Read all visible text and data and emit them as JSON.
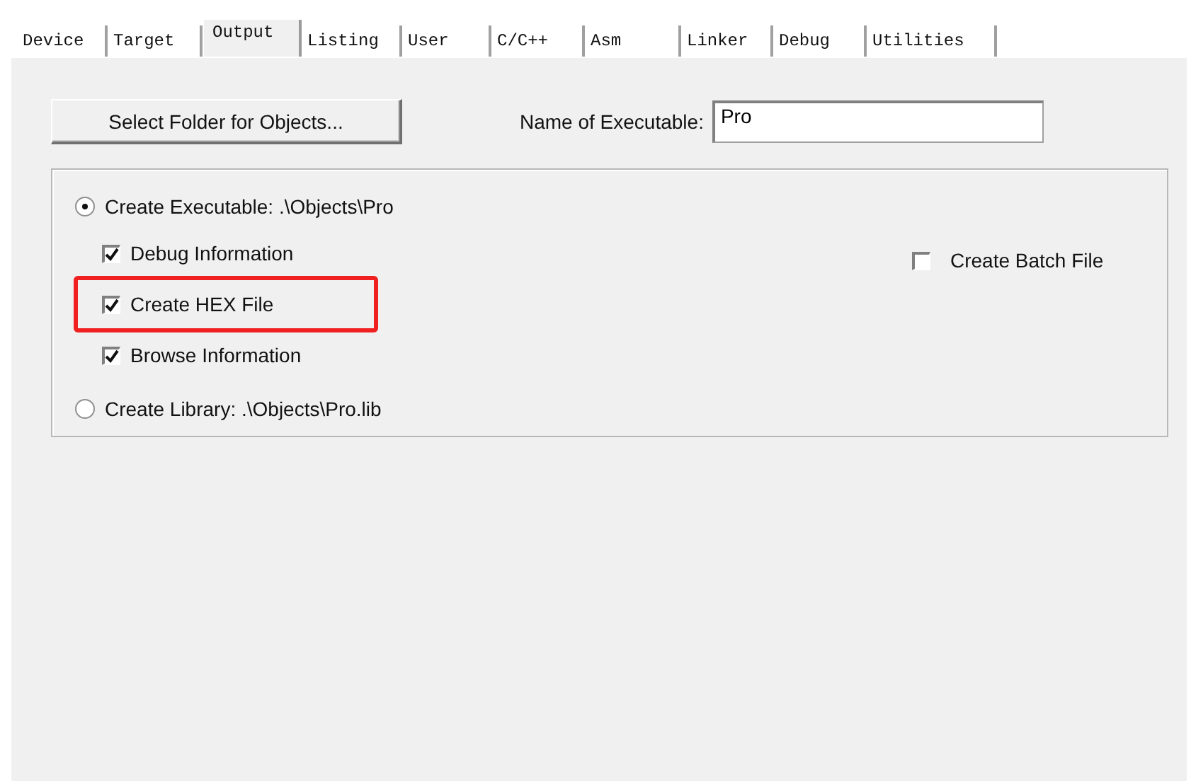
{
  "tabs": [
    {
      "label": "Device",
      "selected": false
    },
    {
      "label": "Target",
      "selected": false
    },
    {
      "label": "Output",
      "selected": true
    },
    {
      "label": "Listing",
      "selected": false
    },
    {
      "label": "User",
      "selected": false
    },
    {
      "label": "C/C++",
      "selected": false
    },
    {
      "label": "Asm",
      "selected": false
    },
    {
      "label": "Linker",
      "selected": false
    },
    {
      "label": "Debug",
      "selected": false
    },
    {
      "label": "Utilities",
      "selected": false
    }
  ],
  "select_folder_button": "Select Folder for Objects...",
  "executable_name": {
    "label": "Name of Executable:",
    "value": "Pro"
  },
  "output_type": [
    {
      "label": "Create Executable:  .\\Objects\\Pro",
      "selected": true,
      "options": [
        {
          "label": "Debug Information",
          "checked": true,
          "highlighted": false
        },
        {
          "label": "Create HEX File",
          "checked": true,
          "highlighted": true
        },
        {
          "label": "Browse Information",
          "checked": true,
          "highlighted": false
        }
      ]
    },
    {
      "label": "Create Library:  .\\Objects\\Pro.lib",
      "selected": false
    }
  ],
  "batch_file": {
    "label": "Create Batch File",
    "checked": false
  }
}
